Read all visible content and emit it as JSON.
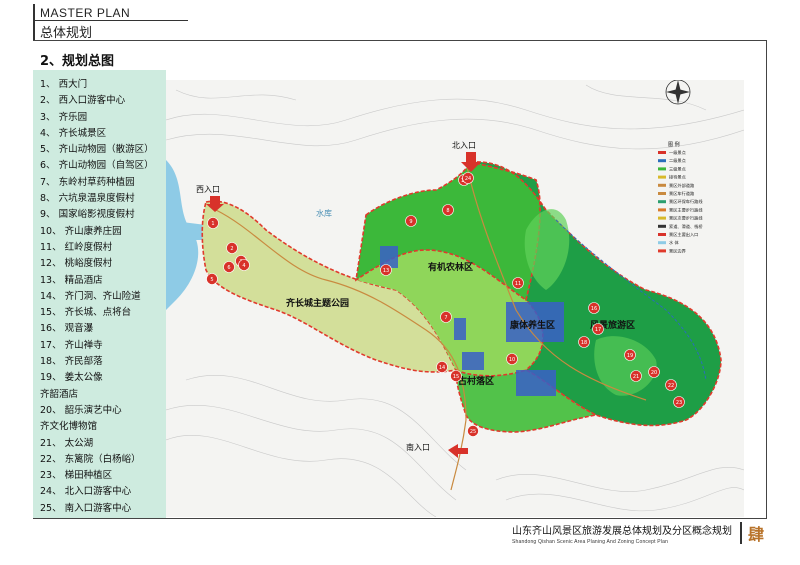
{
  "header": {
    "title_en": "MASTER PLAN",
    "title_cn": "总体规划"
  },
  "section_title": "2、规划总图",
  "legend_items": [
    "1、 西大门",
    "2、 西入口游客中心",
    "3、 齐乐园",
    "4、 齐长城景区",
    "5、 齐山动物园（散游区）",
    "6、 齐山动物园（自驾区）",
    "7、 东岭村草药种植园",
    "8、 六坑泉温泉度假村",
    "9、 国家峪影视度假村",
    "10、 齐山康养庄园",
    "11、 红岭度假村",
    "12、 桃峪度假村",
    "13、 精品酒店",
    "14、 齐门洞、齐山险道",
    "15、 齐长城、点将台",
    "16、 观音瀑",
    "17、 齐山禅寺",
    "18、 齐民部落",
    "19、 姜太公像",
    "       齐韶酒店",
    "20、 韶乐演艺中心",
    "       齐文化博物馆",
    "21、 太公湖",
    "22、 东篱院（白杨峪）",
    "23、 梯田种植区",
    "24、 北入口游客中心",
    "25、 南入口游客中心"
  ],
  "map": {
    "entrances": {
      "north": "北入口",
      "west": "西入口",
      "south": "南入口"
    },
    "zones": [
      "有机农林区",
      "齐长城主题公园",
      "康体养生区",
      "风景旅游区",
      "古村落区"
    ],
    "reservoir_label": "水库",
    "north_arrow_letter": "N",
    "markers": [
      {
        "n": "1"
      },
      {
        "n": "2"
      },
      {
        "n": "3"
      },
      {
        "n": "4"
      },
      {
        "n": "5"
      },
      {
        "n": "6"
      },
      {
        "n": "7"
      },
      {
        "n": "8"
      },
      {
        "n": "9"
      },
      {
        "n": "10"
      },
      {
        "n": "11"
      },
      {
        "n": "12"
      },
      {
        "n": "13"
      },
      {
        "n": "14"
      },
      {
        "n": "15"
      },
      {
        "n": "16"
      },
      {
        "n": "17"
      },
      {
        "n": "18"
      },
      {
        "n": "19"
      },
      {
        "n": "20"
      },
      {
        "n": "21"
      },
      {
        "n": "22"
      },
      {
        "n": "23"
      },
      {
        "n": "24"
      },
      {
        "n": "25"
      }
    ],
    "map_legend": {
      "title": "图  例",
      "items": [
        "一级景点",
        "二级景点",
        "三级景点",
        "接待景点",
        "景区外部道路",
        "景区车行道路",
        "景区环保车行路线",
        "景区主要步行路线",
        "景区次要步行路线",
        "索道、滑道、栈桥",
        "景区主要出入口",
        "水  体",
        "景区边界"
      ]
    },
    "colors": {
      "zone_green": "#3cb83a",
      "zone_dark_green": "#1e9e46",
      "zone_lime": "#8fd65a",
      "zone_pale": "#d3df9a",
      "zone_blue": "#3a5fc8",
      "boundary_red": "#e03a2c",
      "marker_red": "#d8322a",
      "water": "#8ecbe6"
    }
  },
  "footer": {
    "title_cn": "山东齐山风景区旅游发展总体规划及分区概念规划",
    "title_en": "Shandong Qishan Scenic Area Planing And Zoning Concept Plan",
    "mark": "肆"
  }
}
